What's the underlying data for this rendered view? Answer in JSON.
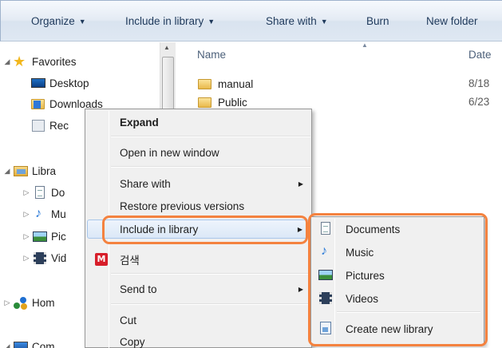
{
  "toolbar": {
    "organize": "Organize",
    "include_in_library": "Include in library",
    "share_with": "Share with",
    "burn": "Burn",
    "new_folder": "New folder"
  },
  "nav": {
    "favorites": "Favorites",
    "desktop": "Desktop",
    "downloads": "Downloads",
    "recent": "Rec",
    "libraries": "Libra",
    "documents": "Do",
    "music": "Mu",
    "pictures": "Pic",
    "videos": "Vid",
    "homegroup": "Hom",
    "computer": "Com"
  },
  "columns": {
    "name": "Name",
    "date": "Date"
  },
  "files": [
    {
      "name": "manual",
      "date": "8/18"
    },
    {
      "name": "Public",
      "date": "6/23"
    }
  ],
  "context_menu": {
    "expand": "Expand",
    "open_new_window": "Open in new window",
    "share_with": "Share with",
    "restore_previous": "Restore previous versions",
    "include_in_library": "Include in library",
    "search_badge": "M",
    "search_korean": "검색",
    "send_to": "Send to",
    "cut": "Cut",
    "copy": "Copy"
  },
  "submenu": {
    "documents": "Documents",
    "music": "Music",
    "pictures": "Pictures",
    "videos": "Videos",
    "create_new_library": "Create new library"
  },
  "colors": {
    "callout": "#f4823f",
    "toolbar_text": "#1e395b",
    "highlight_border": "#a8c6ea"
  }
}
